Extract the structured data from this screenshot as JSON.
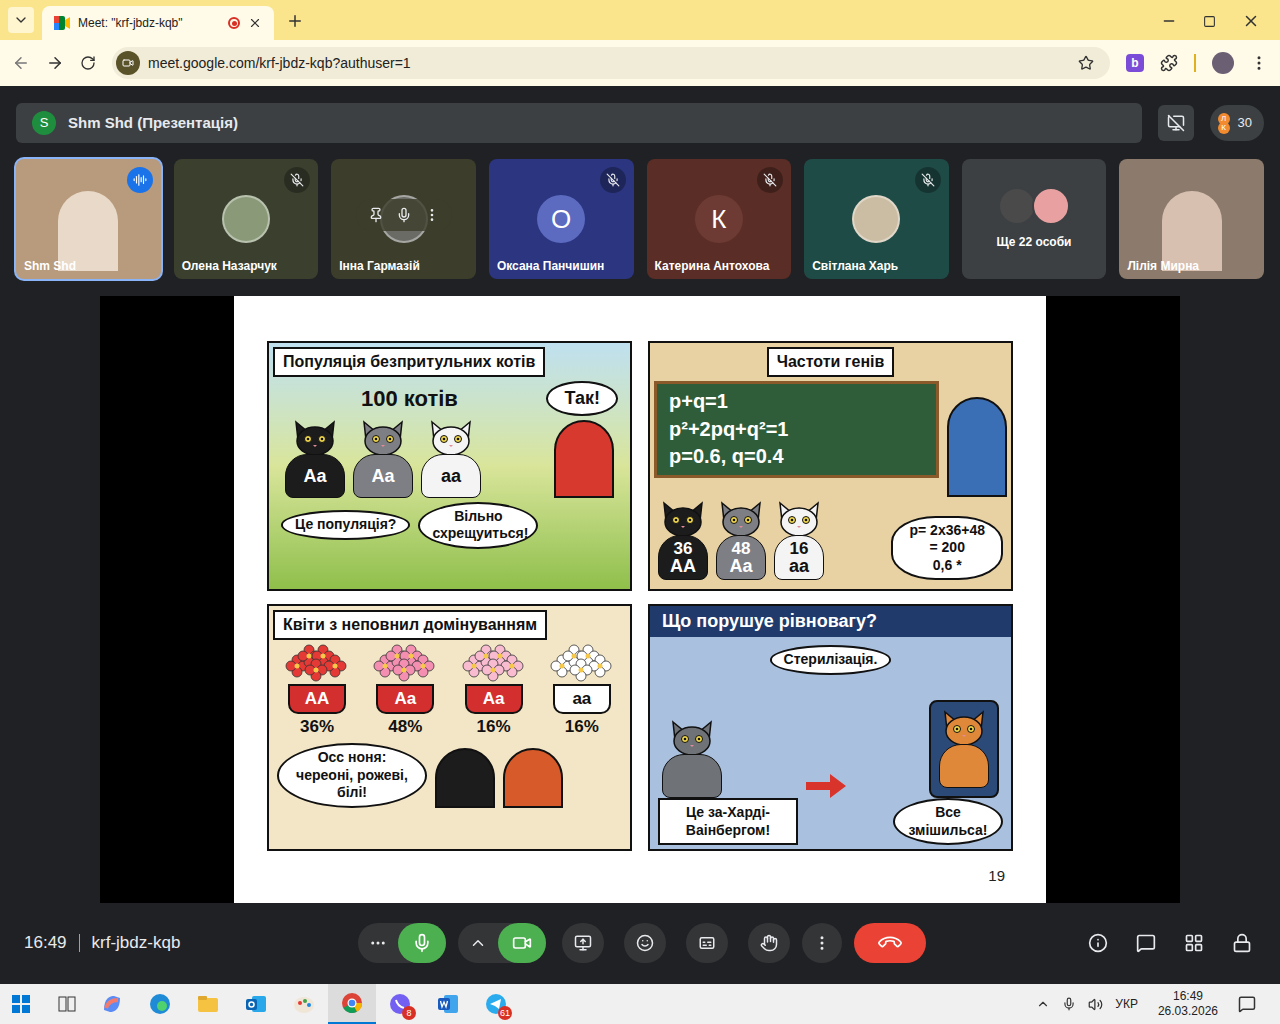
{
  "browser": {
    "tab_title": "Meet: \"krf-jbdz-kqb\"",
    "recording": true,
    "url": "meet.google.com/krf-jbdz-kqb?authuser=1",
    "extension_letter": "b"
  },
  "presentation_bar": {
    "avatar": "S",
    "title": "Shm Shd (Презентація)",
    "mini_avatars": [
      "Л",
      "К"
    ],
    "participant_count": "30"
  },
  "participants": [
    {
      "name": "Shm Shd",
      "kind": "video",
      "muted": false,
      "speaking": true,
      "hovered": false,
      "letter": "",
      "tile_color": "#b89a7c",
      "avatar_color": "#e8d9c8"
    },
    {
      "name": "Олена Назарчук",
      "kind": "photo",
      "muted": true,
      "speaking": false,
      "hovered": false,
      "letter": "",
      "tile_color": "#3b3f2e",
      "avatar_color": "#8a9a78"
    },
    {
      "name": "Інна Гармазій",
      "kind": "photo",
      "muted": false,
      "speaking": false,
      "hovered": true,
      "letter": "",
      "tile_color": "#3c3d2b",
      "avatar_color": "#6b6b66"
    },
    {
      "name": "Оксана Панчишин",
      "kind": "letter",
      "muted": true,
      "speaking": false,
      "hovered": false,
      "letter": "О",
      "tile_color": "#2b3580",
      "avatar_color": "#5c6bc0"
    },
    {
      "name": "Катерина Антохова",
      "kind": "letter",
      "muted": true,
      "speaking": false,
      "hovered": false,
      "letter": "К",
      "tile_color": "#5a2d26",
      "avatar_color": "#6d3b33"
    },
    {
      "name": "Світлана Харь",
      "kind": "photo",
      "muted": true,
      "speaking": false,
      "hovered": false,
      "letter": "",
      "tile_color": "#1f4b47",
      "avatar_color": "#cbbda3"
    },
    {
      "name": "Ще 22 особи",
      "kind": "group",
      "muted": false,
      "speaking": false,
      "hovered": false,
      "letter": "",
      "tile_color": "#3c4043",
      "avatar_color": "#4a4a4a"
    },
    {
      "name": "Лілія Мирна",
      "kind": "video",
      "muted": false,
      "speaking": false,
      "hovered": false,
      "letter": "",
      "tile_color": "#8c7b6c",
      "avatar_color": "#d8c0b0"
    }
  ],
  "slide": {
    "page": "19",
    "panels": [
      {
        "kind": "population",
        "title": "Популяція безпритульних котів",
        "heading": "100 котів",
        "cats": [
          {
            "label": "Aa",
            "color": "#1c1c1c"
          },
          {
            "label": "Aa",
            "color": "#7d7f85"
          },
          {
            "label": "aa",
            "color": "#f4f4f4"
          }
        ],
        "bubbles": [
          "Так!",
          "Це популяція?",
          "Вільно схрещуиться!"
        ]
      },
      {
        "kind": "frequencies",
        "title": "Частоти генів",
        "formulas": [
          "p+q=1",
          "p²+2pq+q²=1",
          "p=0.6, q=0.4"
        ],
        "cats": [
          {
            "count": "36",
            "label": "AA",
            "color": "#1c1c1c"
          },
          {
            "count": "48",
            "label": "Aa",
            "color": "#7d7f85"
          },
          {
            "count": "16",
            "label": "aa",
            "color": "#f4f4f4"
          }
        ],
        "calc": [
          "p= 2x36+48",
          "= 200",
          "0,6 *"
        ]
      },
      {
        "kind": "flowers",
        "title": "Квіти з неповнил домінуванням",
        "flowers": [
          {
            "label": "AA",
            "percent": "36%",
            "color": "#e53935"
          },
          {
            "label": "Aa",
            "percent": "48%",
            "color": "#f48fb1"
          },
          {
            "label": "Aa",
            "percent": "16%",
            "color": "#f8bbd0"
          },
          {
            "label": "aa",
            "percent": "16%",
            "color": "#ffffff"
          }
        ],
        "bubble": "Осс ноня: череоні, рожеві, білі!"
      },
      {
        "kind": "disruption",
        "title": "Що порушуе рівновагу?",
        "bubble": "Стерилізація.",
        "banner": "Це за-Харді-Ваінбергом!",
        "shout": "Все змішильса!",
        "cats": [
          {
            "color": "#6f7378"
          },
          {
            "color": "#e0883a"
          }
        ]
      }
    ]
  },
  "controls": {
    "time": "16:49",
    "meeting_code": "krf-jbdz-kqb",
    "mic_on": true,
    "camera_on": true
  },
  "taskbar": {
    "apps": [
      {
        "kind": "copilot",
        "active": false,
        "badge": ""
      },
      {
        "kind": "edge",
        "active": false,
        "badge": ""
      },
      {
        "kind": "explorer",
        "active": false,
        "badge": ""
      },
      {
        "kind": "outlook",
        "active": false,
        "badge": ""
      },
      {
        "kind": "paint",
        "active": false,
        "badge": ""
      },
      {
        "kind": "chrome",
        "active": true,
        "badge": ""
      },
      {
        "kind": "viber",
        "active": false,
        "badge": "8"
      },
      {
        "kind": "word",
        "active": false,
        "badge": ""
      },
      {
        "kind": "telegram",
        "active": false,
        "badge": "61"
      }
    ],
    "language": "УКР",
    "time": "16:49",
    "date": "26.03.2026"
  }
}
